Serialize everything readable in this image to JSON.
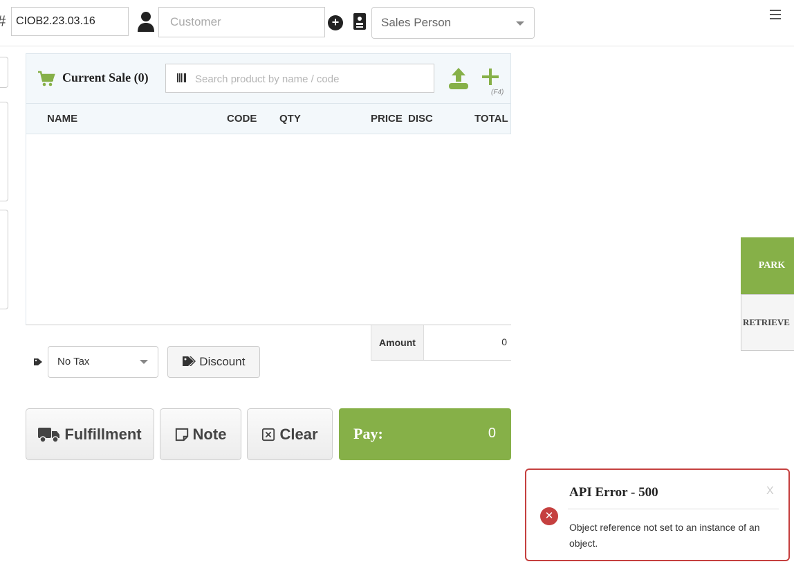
{
  "topbar": {
    "hash_symbol": "#",
    "terminal_id": "CIOB2.23.03.16",
    "customer_placeholder": "Customer",
    "add_customer_symbol": "+",
    "sales_person_placeholder": "Sales Person"
  },
  "sale": {
    "title": "Current Sale (0)",
    "search_placeholder": "Search product by name / code",
    "add_shortcut": "(F4)",
    "columns": [
      "NAME",
      "CODE",
      "QTY",
      "PRICE",
      "DISC",
      "TOTAL"
    ],
    "amount_label": "Amount",
    "amount_value": "0"
  },
  "controls": {
    "tax_selected": "No Tax",
    "discount_label": "Discount",
    "fulfillment_label": "Fulfillment",
    "note_label": "Note",
    "clear_label": "Clear",
    "pay_label": "Pay:",
    "pay_value": "0"
  },
  "side": {
    "park_label": "PARK",
    "retrieve_label": "RETRIEVE"
  },
  "toast": {
    "title": "API Error - 500",
    "close_label": "X",
    "message": "Object reference not set to an instance of an object."
  },
  "colors": {
    "accent_green": "#86b048",
    "error_red": "#c5403f",
    "header_bg": "#f3f8fb"
  },
  "icons": [
    "hash-icon",
    "person-icon",
    "add-circle-icon",
    "contact-card-icon",
    "menu-icon",
    "cart-icon",
    "barcode-icon",
    "upload-icon",
    "plus-icon",
    "tag-icon",
    "truck-icon",
    "note-icon",
    "clear-icon",
    "error-icon"
  ]
}
